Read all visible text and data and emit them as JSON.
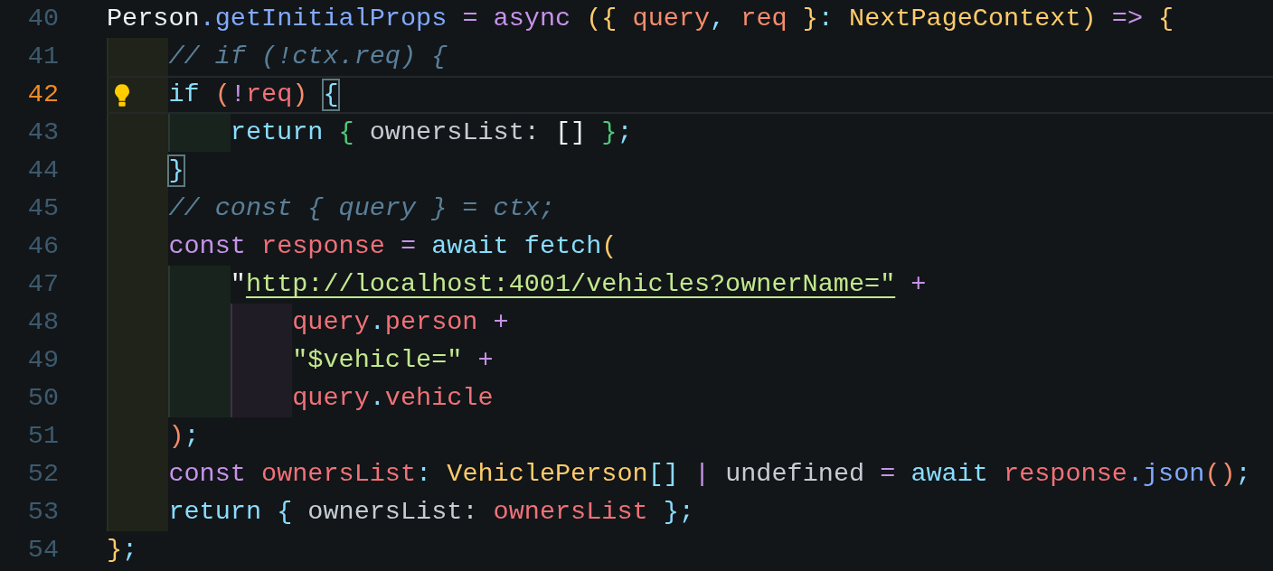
{
  "lines": [
    {
      "number": "40",
      "current": false,
      "tokens": [
        {
          "kind": "plain",
          "text": "Person"
        },
        {
          "kind": "fn",
          "text": ".getInitialProps"
        },
        {
          "kind": "op",
          "text": " ="
        },
        {
          "kind": "kw",
          "text": " async"
        },
        {
          "kind": "brace",
          "text": " ({"
        },
        {
          "kind": "param",
          "text": " query"
        },
        {
          "kind": "punct",
          "text": ","
        },
        {
          "kind": "param",
          "text": " req"
        },
        {
          "kind": "brace",
          "text": " }"
        },
        {
          "kind": "punct",
          "text": ":"
        },
        {
          "kind": "type",
          "text": " NextPageContext"
        },
        {
          "kind": "brace",
          "text": ")"
        },
        {
          "kind": "op",
          "text": " =>"
        },
        {
          "kind": "brace",
          "text": " {"
        }
      ]
    },
    {
      "number": "41",
      "current": false,
      "guides": [
        {
          "kind": "outer"
        }
      ],
      "tokens": [
        {
          "kind": "comment",
          "text": "// if (!ctx.req) {"
        }
      ]
    },
    {
      "number": "42",
      "current": true,
      "guides": [
        {
          "kind": "outer"
        }
      ],
      "tokens": [
        {
          "kind": "ctrl",
          "text": "if"
        },
        {
          "kind": "paren",
          "text": " ("
        },
        {
          "kind": "op",
          "text": "!"
        },
        {
          "kind": "var",
          "text": "req"
        },
        {
          "kind": "paren",
          "text": ") "
        },
        {
          "kind": "ctrl",
          "text": "{",
          "matched": true
        }
      ]
    },
    {
      "number": "43",
      "current": false,
      "guides": [
        {
          "kind": "outer"
        },
        {
          "kind": "inner"
        }
      ],
      "tokens": [
        {
          "kind": "ctrl",
          "text": "return"
        },
        {
          "kind": "green",
          "text": " {"
        },
        {
          "kind": "prop",
          "text": " ownersList:"
        },
        {
          "kind": "plain",
          "text": " []"
        },
        {
          "kind": "green",
          "text": " }"
        },
        {
          "kind": "punct",
          "text": ";"
        }
      ]
    },
    {
      "number": "44",
      "current": false,
      "guides": [
        {
          "kind": "outer"
        }
      ],
      "tokens": [
        {
          "kind": "ctrl",
          "text": "}",
          "matched": true
        }
      ]
    },
    {
      "number": "45",
      "current": false,
      "guides": [
        {
          "kind": "outer"
        }
      ],
      "tokens": [
        {
          "kind": "comment",
          "text": "// const { query } = ctx;"
        }
      ]
    },
    {
      "number": "46",
      "current": false,
      "guides": [
        {
          "kind": "outer"
        }
      ],
      "tokens": [
        {
          "kind": "kw",
          "text": "const"
        },
        {
          "kind": "var",
          "text": " response"
        },
        {
          "kind": "op",
          "text": " ="
        },
        {
          "kind": "ctrl",
          "text": " await"
        },
        {
          "kind": "ctrl",
          "text": " fetch"
        },
        {
          "kind": "brace",
          "text": "("
        }
      ]
    },
    {
      "number": "47",
      "current": false,
      "guides": [
        {
          "kind": "outer"
        },
        {
          "kind": "inner"
        }
      ],
      "tokens": [
        {
          "kind": "plain",
          "text": "\""
        },
        {
          "kind": "link",
          "text": "http://localhost:4001/vehicles?ownerName=\""
        },
        {
          "kind": "op",
          "text": " +"
        }
      ]
    },
    {
      "number": "48",
      "current": false,
      "guides": [
        {
          "kind": "outer"
        },
        {
          "kind": "inner"
        },
        {
          "kind": "deep"
        }
      ],
      "tokens": [
        {
          "kind": "var",
          "text": "query"
        },
        {
          "kind": "punct",
          "text": "."
        },
        {
          "kind": "var",
          "text": "person"
        },
        {
          "kind": "op",
          "text": " +"
        }
      ]
    },
    {
      "number": "49",
      "current": false,
      "guides": [
        {
          "kind": "outer"
        },
        {
          "kind": "inner"
        },
        {
          "kind": "deep"
        }
      ],
      "tokens": [
        {
          "kind": "string",
          "text": "\"$vehicle=\""
        },
        {
          "kind": "op",
          "text": " +"
        }
      ]
    },
    {
      "number": "50",
      "current": false,
      "guides": [
        {
          "kind": "outer"
        },
        {
          "kind": "inner"
        },
        {
          "kind": "deep"
        }
      ],
      "tokens": [
        {
          "kind": "var",
          "text": "query"
        },
        {
          "kind": "punct",
          "text": "."
        },
        {
          "kind": "var",
          "text": "vehicle"
        }
      ]
    },
    {
      "number": "51",
      "current": false,
      "guides": [
        {
          "kind": "outer"
        }
      ],
      "tokens": [
        {
          "kind": "paren",
          "text": ")"
        },
        {
          "kind": "punct",
          "text": ";"
        }
      ]
    },
    {
      "number": "52",
      "current": false,
      "guides": [
        {
          "kind": "outer"
        }
      ],
      "tokens": [
        {
          "kind": "kw",
          "text": "const"
        },
        {
          "kind": "var",
          "text": " ownersList"
        },
        {
          "kind": "punct",
          "text": ":"
        },
        {
          "kind": "type",
          "text": " VehiclePerson"
        },
        {
          "kind": "punct",
          "text": "[]"
        },
        {
          "kind": "op",
          "text": " |"
        },
        {
          "kind": "prop",
          "text": " undefined"
        },
        {
          "kind": "op",
          "text": " ="
        },
        {
          "kind": "ctrl",
          "text": " await"
        },
        {
          "kind": "var",
          "text": " response"
        },
        {
          "kind": "fn",
          "text": ".json"
        },
        {
          "kind": "paren",
          "text": "()"
        },
        {
          "kind": "punct",
          "text": ";"
        }
      ]
    },
    {
      "number": "53",
      "current": false,
      "guides": [
        {
          "kind": "outer"
        }
      ],
      "tokens": [
        {
          "kind": "ctrl",
          "text": "return"
        },
        {
          "kind": "punct",
          "text": " {"
        },
        {
          "kind": "prop",
          "text": " ownersList:"
        },
        {
          "kind": "var",
          "text": " ownersList"
        },
        {
          "kind": "punct",
          "text": " }"
        },
        {
          "kind": "punct",
          "text": ";"
        }
      ]
    },
    {
      "number": "54",
      "current": false,
      "tokens": [
        {
          "kind": "brace",
          "text": "}"
        },
        {
          "kind": "punct",
          "text": ";"
        }
      ]
    }
  ]
}
